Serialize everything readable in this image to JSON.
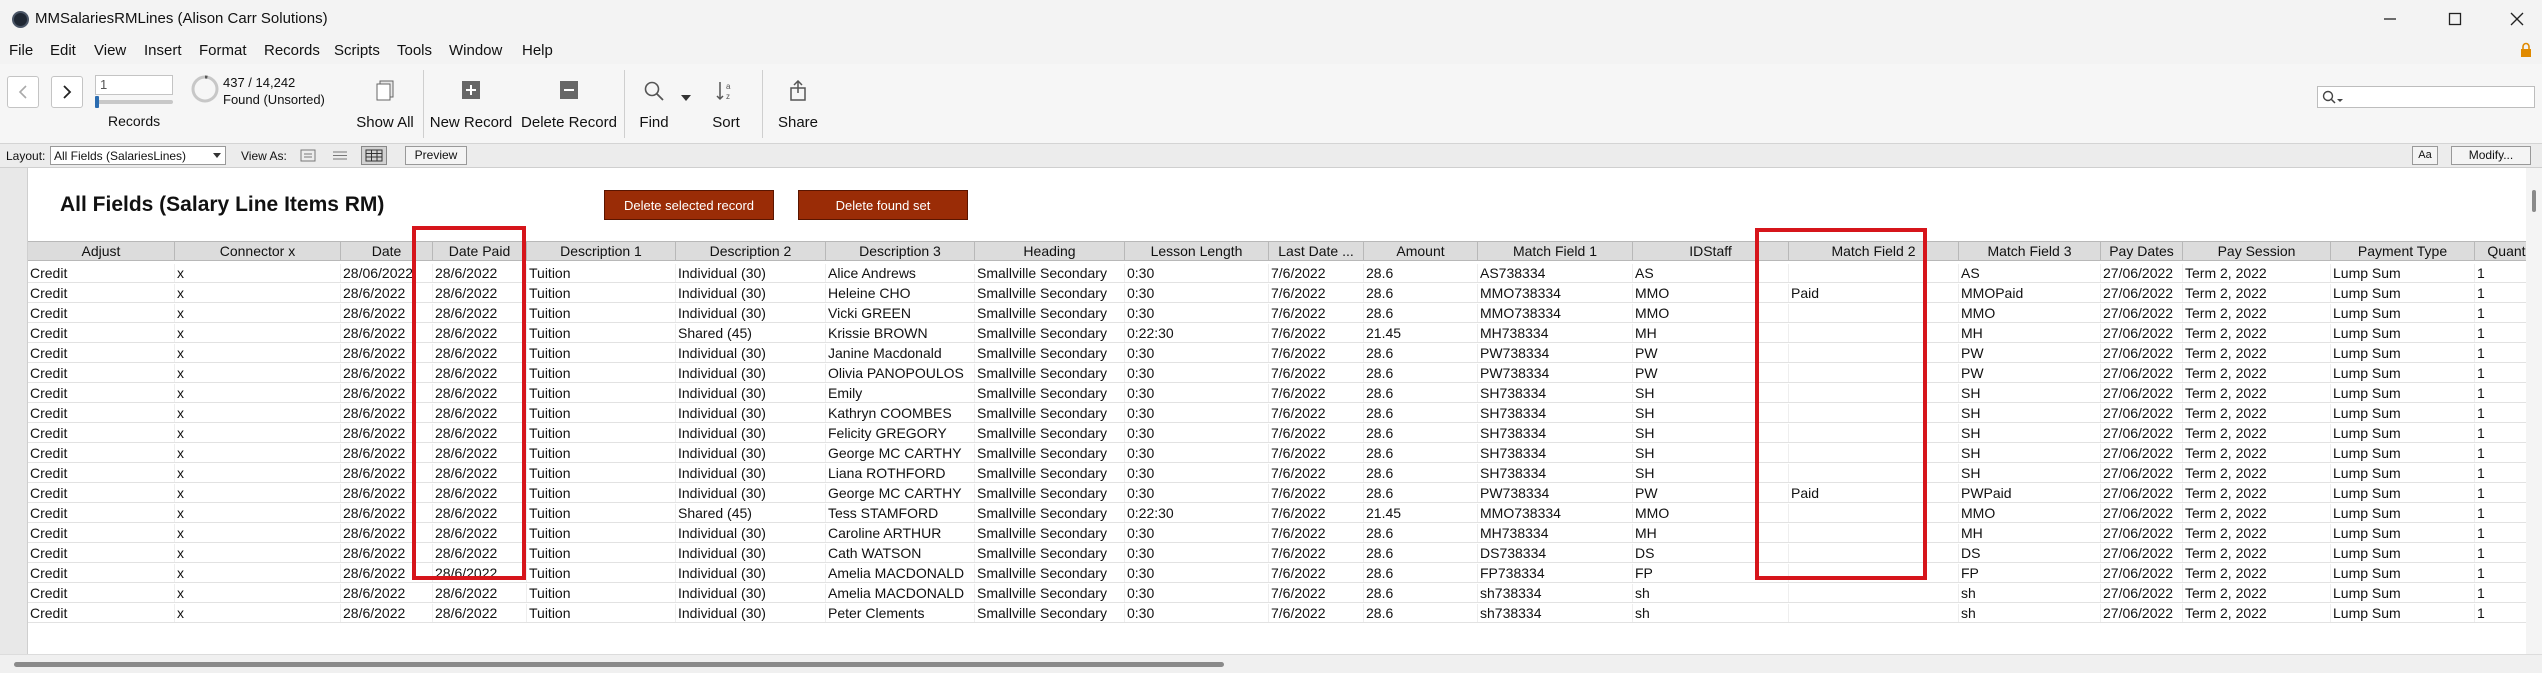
{
  "window": {
    "title": "MMSalariesRMLines (Alison Carr Solutions)"
  },
  "menu": [
    "File",
    "Edit",
    "View",
    "Insert",
    "Format",
    "Records",
    "Scripts",
    "Tools",
    "Window",
    "Help"
  ],
  "toolbar": {
    "record_number": "1",
    "records_label": "Records",
    "found_count": "437 / 14,242",
    "found_status": "Found (Unsorted)",
    "show_all": "Show All",
    "new_record": "New Record",
    "delete_record": "Delete Record",
    "find": "Find",
    "sort": "Sort",
    "share": "Share",
    "search_placeholder": ""
  },
  "layoutbar": {
    "layout_label": "Layout:",
    "layout_value": "All Fields (SalariesLines)",
    "view_as_label": "View As:",
    "preview": "Preview",
    "aa": "Aa",
    "modify": "Modify..."
  },
  "page": {
    "title": "All Fields (Salary Line Items RM)",
    "delete_selected": "Delete selected record",
    "delete_found": "Delete found set"
  },
  "columns": [
    "Adjust",
    "Connector x",
    "Date",
    "Date Paid",
    "Description 1",
    "Description 2",
    "Description 3",
    "Heading",
    "Lesson Length",
    "Last Date ...",
    "Amount",
    "Match Field 1",
    "IDStaff",
    "Match Field 2",
    "Match Field 3",
    "Pay Dates",
    "Pay Session",
    "Payment Type",
    "Quantity"
  ],
  "rows": [
    [
      "Credit",
      "x",
      "28/06/2022",
      "28/6/2022",
      "Tuition",
      "Individual (30)",
      "Alice Andrews",
      "Smallville Secondary",
      "0:30",
      "7/6/2022",
      "28.6",
      "AS738334",
      "AS",
      "",
      "AS",
      "27/06/2022",
      "Term 2, 2022",
      "Lump Sum",
      "1"
    ],
    [
      "Credit",
      "x",
      "28/6/2022",
      "28/6/2022",
      "Tuition",
      "Individual (30)",
      "Heleine CHO",
      "Smallville Secondary",
      "0:30",
      "7/6/2022",
      "28.6",
      "MMO738334",
      "MMO",
      "Paid",
      "MMOPaid",
      "27/06/2022",
      "Term 2, 2022",
      "Lump Sum",
      "1"
    ],
    [
      "Credit",
      "x",
      "28/6/2022",
      "28/6/2022",
      "Tuition",
      "Individual (30)",
      "Vicki GREEN",
      "Smallville Secondary",
      "0:30",
      "7/6/2022",
      "28.6",
      "MMO738334",
      "MMO",
      "",
      "MMO",
      "27/06/2022",
      "Term 2, 2022",
      "Lump Sum",
      "1"
    ],
    [
      "Credit",
      "x",
      "28/6/2022",
      "28/6/2022",
      "Tuition",
      "Shared (45)",
      "Krissie BROWN",
      "Smallville Secondary",
      "0:22:30",
      "7/6/2022",
      "21.45",
      "MH738334",
      "MH",
      "",
      "MH",
      "27/06/2022",
      "Term 2, 2022",
      "Lump Sum",
      "1"
    ],
    [
      "Credit",
      "x",
      "28/6/2022",
      "28/6/2022",
      "Tuition",
      "Individual (30)",
      "Janine Macdonald",
      "Smallville Secondary",
      "0:30",
      "7/6/2022",
      "28.6",
      "PW738334",
      "PW",
      "",
      "PW",
      "27/06/2022",
      "Term 2, 2022",
      "Lump Sum",
      "1"
    ],
    [
      "Credit",
      "x",
      "28/6/2022",
      "28/6/2022",
      "Tuition",
      "Individual (30)",
      "Olivia PANOPOULOS",
      "Smallville Secondary",
      "0:30",
      "7/6/2022",
      "28.6",
      "PW738334",
      "PW",
      "",
      "PW",
      "27/06/2022",
      "Term 2, 2022",
      "Lump Sum",
      "1"
    ],
    [
      "Credit",
      "x",
      "28/6/2022",
      "28/6/2022",
      "Tuition",
      "Individual (30)",
      "Emily",
      "Smallville Secondary",
      "0:30",
      "7/6/2022",
      "28.6",
      "SH738334",
      "SH",
      "",
      "SH",
      "27/06/2022",
      "Term 2, 2022",
      "Lump Sum",
      "1"
    ],
    [
      "Credit",
      "x",
      "28/6/2022",
      "28/6/2022",
      "Tuition",
      "Individual (30)",
      "Kathryn COOMBES",
      "Smallville Secondary",
      "0:30",
      "7/6/2022",
      "28.6",
      "SH738334",
      "SH",
      "",
      "SH",
      "27/06/2022",
      "Term 2, 2022",
      "Lump Sum",
      "1"
    ],
    [
      "Credit",
      "x",
      "28/6/2022",
      "28/6/2022",
      "Tuition",
      "Individual (30)",
      "Felicity GREGORY",
      "Smallville Secondary",
      "0:30",
      "7/6/2022",
      "28.6",
      "SH738334",
      "SH",
      "",
      "SH",
      "27/06/2022",
      "Term 2, 2022",
      "Lump Sum",
      "1"
    ],
    [
      "Credit",
      "x",
      "28/6/2022",
      "28/6/2022",
      "Tuition",
      "Individual (30)",
      "George MC CARTHY",
      "Smallville Secondary",
      "0:30",
      "7/6/2022",
      "28.6",
      "SH738334",
      "SH",
      "",
      "SH",
      "27/06/2022",
      "Term 2, 2022",
      "Lump Sum",
      "1"
    ],
    [
      "Credit",
      "x",
      "28/6/2022",
      "28/6/2022",
      "Tuition",
      "Individual (30)",
      "Liana ROTHFORD",
      "Smallville Secondary",
      "0:30",
      "7/6/2022",
      "28.6",
      "SH738334",
      "SH",
      "",
      "SH",
      "27/06/2022",
      "Term 2, 2022",
      "Lump Sum",
      "1"
    ],
    [
      "Credit",
      "x",
      "28/6/2022",
      "28/6/2022",
      "Tuition",
      "Individual (30)",
      "George MC CARTHY",
      "Smallville Secondary",
      "0:30",
      "7/6/2022",
      "28.6",
      "PW738334",
      "PW",
      "Paid",
      "PWPaid",
      "27/06/2022",
      "Term 2, 2022",
      "Lump Sum",
      "1"
    ],
    [
      "Credit",
      "x",
      "28/6/2022",
      "28/6/2022",
      "Tuition",
      "Shared (45)",
      "Tess STAMFORD",
      "Smallville Secondary",
      "0:22:30",
      "7/6/2022",
      "21.45",
      "MMO738334",
      "MMO",
      "",
      "MMO",
      "27/06/2022",
      "Term 2, 2022",
      "Lump Sum",
      "1"
    ],
    [
      "Credit",
      "x",
      "28/6/2022",
      "28/6/2022",
      "Tuition",
      "Individual (30)",
      "Caroline ARTHUR",
      "Smallville Secondary",
      "0:30",
      "7/6/2022",
      "28.6",
      "MH738334",
      "MH",
      "",
      "MH",
      "27/06/2022",
      "Term 2, 2022",
      "Lump Sum",
      "1"
    ],
    [
      "Credit",
      "x",
      "28/6/2022",
      "28/6/2022",
      "Tuition",
      "Individual (30)",
      "Cath WATSON",
      "Smallville Secondary",
      "0:30",
      "7/6/2022",
      "28.6",
      "DS738334",
      "DS",
      "",
      "DS",
      "27/06/2022",
      "Term 2, 2022",
      "Lump Sum",
      "1"
    ],
    [
      "Credit",
      "x",
      "28/6/2022",
      "28/6/2022",
      "Tuition",
      "Individual (30)",
      "Amelia MACDONALD",
      "Smallville Secondary",
      "0:30",
      "7/6/2022",
      "28.6",
      "FP738334",
      "FP",
      "",
      "FP",
      "27/06/2022",
      "Term 2, 2022",
      "Lump Sum",
      "1"
    ],
    [
      "Credit",
      "x",
      "28/6/2022",
      "28/6/2022",
      "Tuition",
      "Individual (30)",
      "Amelia MACDONALD",
      "Smallville Secondary",
      "0:30",
      "7/6/2022",
      "28.6",
      "sh738334",
      "sh",
      "",
      "sh",
      "27/06/2022",
      "Term 2, 2022",
      "Lump Sum",
      "1"
    ],
    [
      "Credit",
      "x",
      "28/6/2022",
      "28/6/2022",
      "Tuition",
      "Individual (30)",
      "Peter Clements",
      "Smallville Secondary",
      "0:30",
      "7/6/2022",
      "28.6",
      "sh738334",
      "sh",
      "",
      "sh",
      "27/06/2022",
      "Term 2, 2022",
      "Lump Sum",
      "1"
    ]
  ],
  "colors": {
    "highlight": "#d6151b",
    "action_button": "#9a2c06",
    "header": "#dcdcdc"
  },
  "icons": [
    "app-icon",
    "minimize-icon",
    "maximize-icon",
    "close-icon",
    "lock-icon",
    "back-icon",
    "forward-icon",
    "found-pie-icon",
    "show-all-icon",
    "new-record-icon",
    "delete-record-icon",
    "find-icon",
    "sort-icon",
    "share-icon",
    "search-icon"
  ]
}
